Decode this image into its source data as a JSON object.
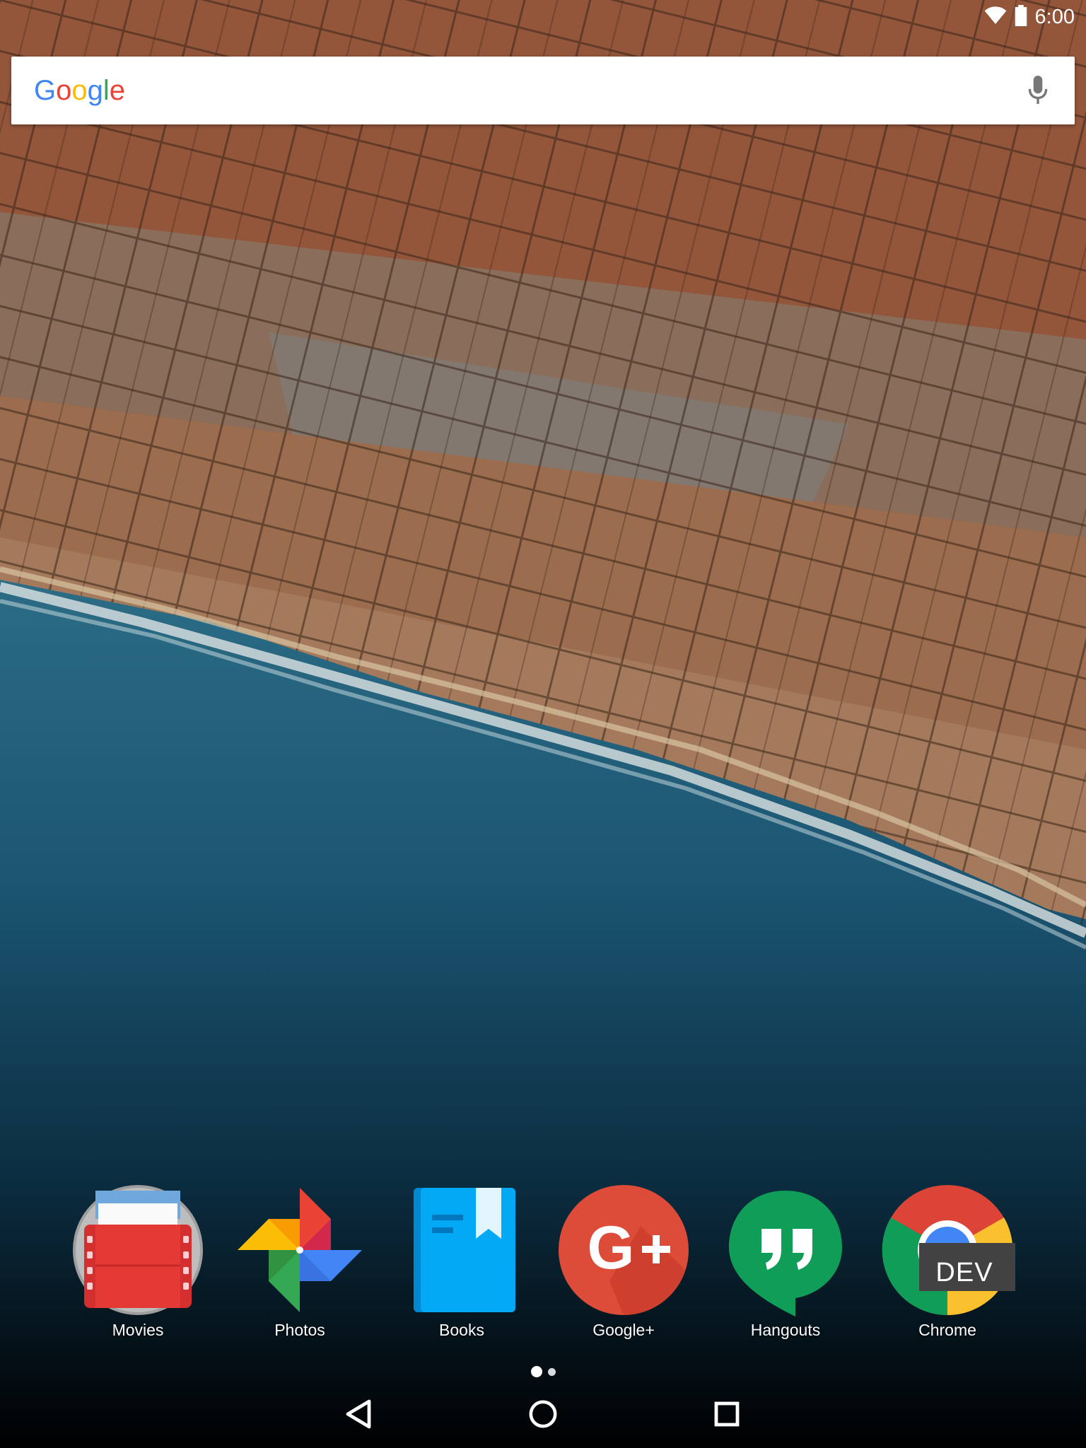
{
  "status_bar": {
    "time": "6:00",
    "icons": [
      "wifi-icon",
      "battery-icon"
    ]
  },
  "search_bar": {
    "logo_letters": [
      {
        "char": "G",
        "color": "#4285F4"
      },
      {
        "char": "o",
        "color": "#EA4335"
      },
      {
        "char": "o",
        "color": "#FBBC05"
      },
      {
        "char": "g",
        "color": "#4285F4"
      },
      {
        "char": "l",
        "color": "#34A853"
      },
      {
        "char": "e",
        "color": "#EA4335"
      }
    ],
    "mic_icon": "mic-icon"
  },
  "dock": {
    "apps": [
      {
        "label": "Movies",
        "icon": "movies-icon"
      },
      {
        "label": "Photos",
        "icon": "photos-icon"
      },
      {
        "label": "Books",
        "icon": "books-icon"
      },
      {
        "label": "Google+",
        "icon": "google-plus-icon"
      },
      {
        "label": "Hangouts",
        "icon": "hangouts-icon"
      },
      {
        "label": "Chrome",
        "icon": "chrome-dev-icon",
        "badge": "DEV"
      }
    ]
  },
  "page_indicator": {
    "pages": 2,
    "current": 1
  },
  "nav_bar": {
    "buttons": [
      "back-icon",
      "home-icon",
      "recents-icon"
    ]
  },
  "colors": {
    "search_bg": "#FFFFFF",
    "label_color": "#FFFFFF"
  }
}
